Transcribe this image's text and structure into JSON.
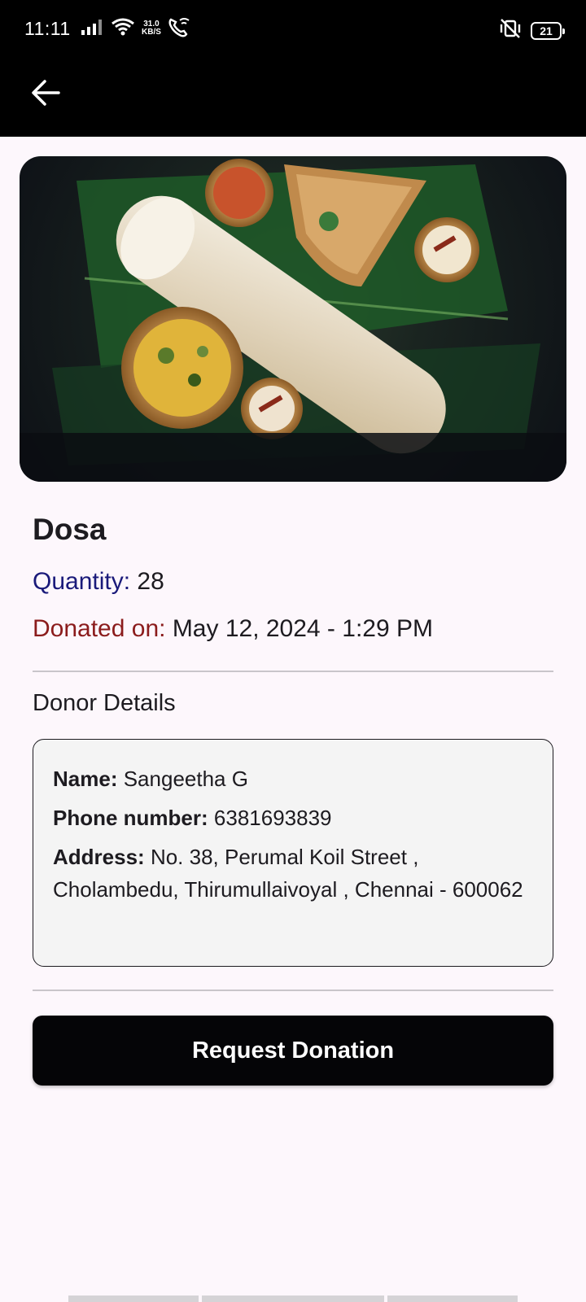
{
  "status_bar": {
    "time": "11:11",
    "net_speed_value": "31.0",
    "net_speed_unit": "KB/S",
    "battery": "21",
    "icons": [
      "signal-icon",
      "wifi-icon",
      "wifi-calling-icon",
      "vibrate-icon",
      "battery-icon"
    ]
  },
  "app_bar": {
    "back_icon": "arrow-left-icon"
  },
  "food": {
    "name": "Dosa",
    "quantity_label": "Quantity:",
    "quantity_value": "28",
    "donated_label": "Donated on:",
    "donated_value": "May 12, 2024 - 1:29 PM"
  },
  "donor": {
    "heading": "Donor Details",
    "name_label": "Name:",
    "name_value": "Sangeetha G",
    "phone_label": "Phone number:",
    "phone_value": "6381693839",
    "address_label": "Address:",
    "address_value": "No. 38, Perumal Koil Street , Cholambedu, Thirumullaivoyal , Chennai  - 600062"
  },
  "actions": {
    "request_label": "Request Donation"
  },
  "colors": {
    "quantity_label": "#1a1a7a",
    "donated_label": "#8b1c1c",
    "button_bg": "#050507",
    "page_bg": "#fdf7fc"
  }
}
